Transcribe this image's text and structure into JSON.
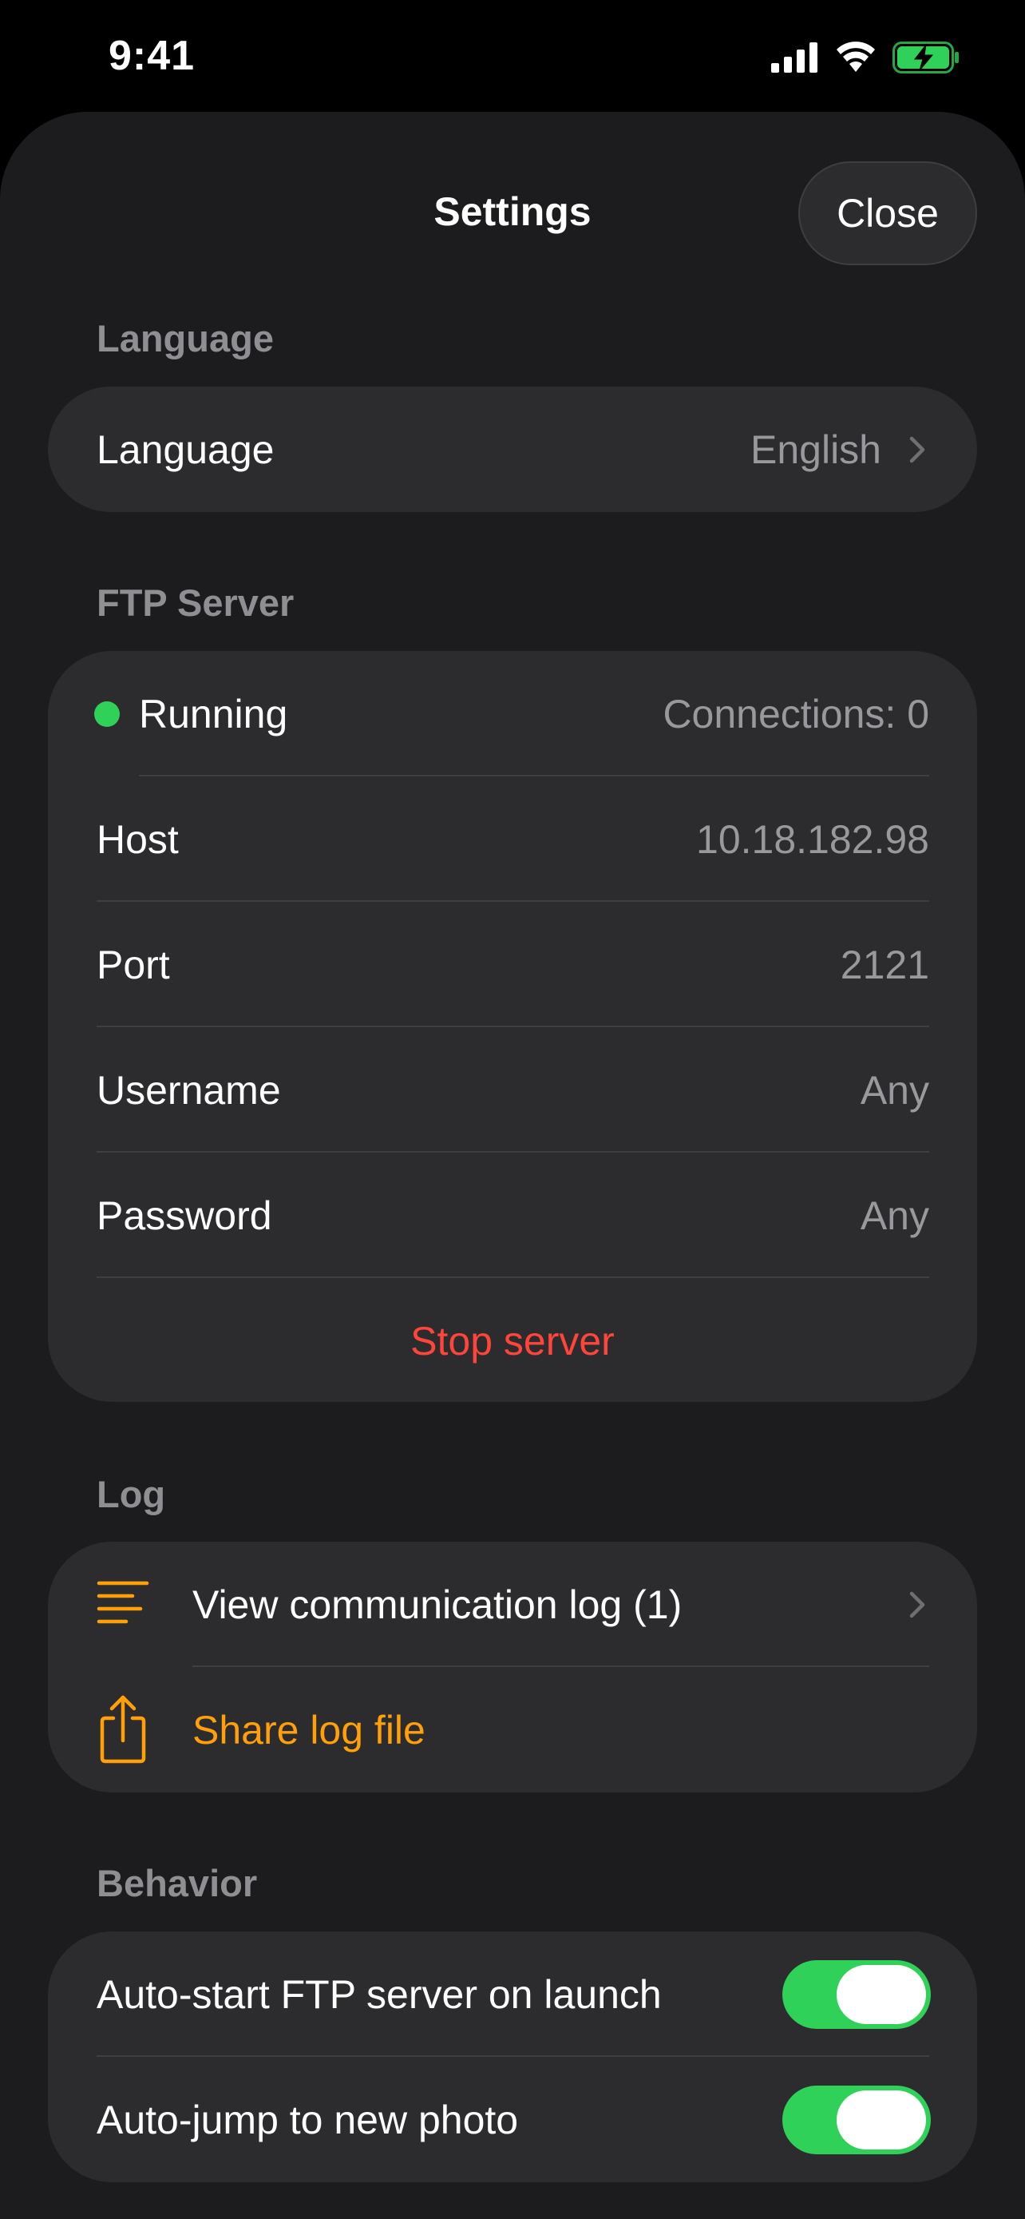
{
  "status_bar": {
    "time": "9:41",
    "icons": [
      "signal-icon",
      "wifi-icon",
      "battery-charging-icon"
    ]
  },
  "nav": {
    "title": "Settings",
    "close_label": "Close"
  },
  "language": {
    "header": "Language",
    "row_label": "Language",
    "row_value": "English"
  },
  "ftp_server": {
    "header": "FTP Server",
    "status_label": "Running",
    "connections": "Connections: 0",
    "host_label": "Host",
    "host_value": "10.18.182.98",
    "port_label": "Port",
    "port_value": "2121",
    "username_label": "Username",
    "username_value": "Any",
    "password_label": "Password",
    "password_value": "Any",
    "stop_label": "Stop server"
  },
  "log": {
    "header": "Log",
    "view_label": "View communication log (1)",
    "share_label": "Share log file"
  },
  "behavior": {
    "header": "Behavior",
    "autostart_label": "Auto-start FTP server on launch",
    "autostart_on": true,
    "autojump_label": "Auto-jump to new photo",
    "autojump_on": true
  },
  "colors": {
    "accent_orange": "#ff9f0a",
    "running_green": "#30d158",
    "destructive_red": "#ff453a",
    "toggle_on": "#30d158",
    "sheet_bg": "#1c1c1e",
    "card_bg": "#2c2c2e"
  }
}
